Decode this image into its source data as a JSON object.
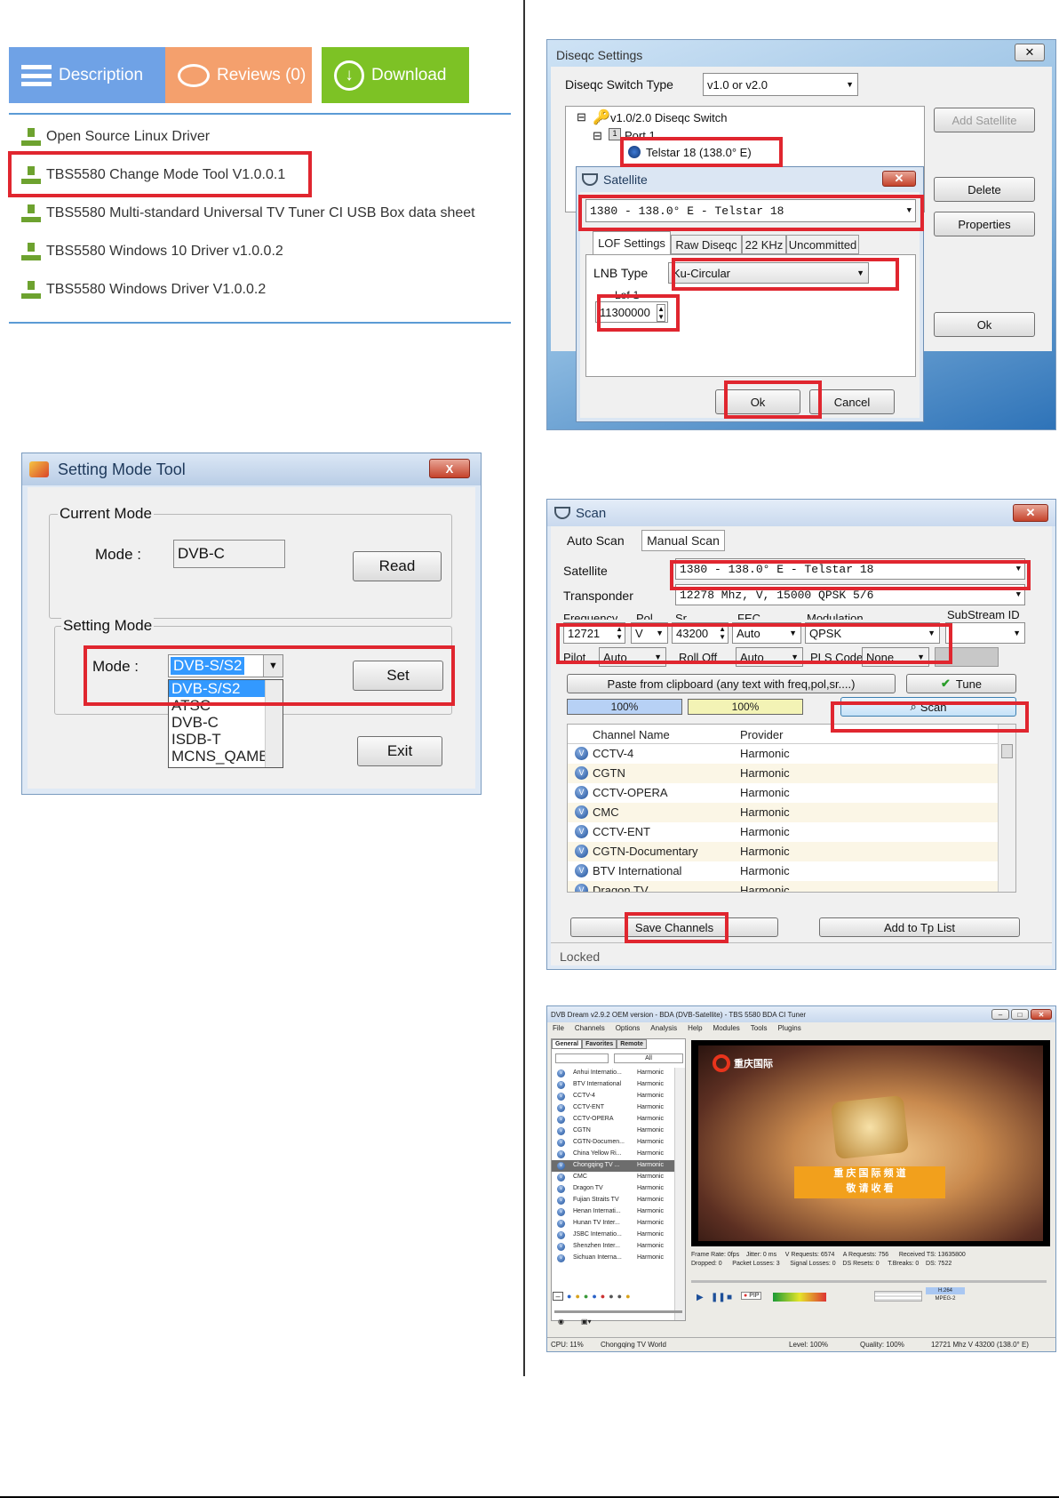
{
  "tabs": {
    "description": "Description",
    "reviews": "Reviews (0)",
    "download": "Download"
  },
  "downloads": [
    "Open Source Linux Driver",
    "TBS5580 Change Mode Tool V1.0.0.1",
    "TBS5580 Multi-standard Universal TV Tuner CI USB Box data sheet",
    "TBS5580 Windows 10 Driver v1.0.0.2",
    "TBS5580 Windows Driver V1.0.0.2"
  ],
  "mode_tool": {
    "title": "Setting Mode Tool",
    "current_group": "Current Mode",
    "mode_label": "Mode :",
    "current_value": "DVB-C",
    "read": "Read",
    "setting_group": "Setting Mode",
    "mode_label2": "Mode :",
    "selected": "DVB-S/S2",
    "options": [
      "DVB-S/S2",
      "ATSC",
      "DVB-C",
      "ISDB-T",
      "MCNS_QAMB"
    ],
    "set": "Set",
    "exit": "Exit",
    "close": "X"
  },
  "diseqc": {
    "title": "Diseqc Settings",
    "switch_label": "Diseqc Switch Type",
    "switch_value": "v1.0 or v2.0",
    "tree_root": "v1.0/2.0 Diseqc Switch",
    "tree_port": "Port 1",
    "tree_sat": "Telstar 18  (138.0° E)",
    "port_num": "1",
    "add_satellite": "Add Satellite",
    "delete": "Delete",
    "properties": "Properties",
    "ok": "Ok"
  },
  "satellite": {
    "title": "Satellite",
    "selected": "1380 - 138.0° E - Telstar 18",
    "tabs": [
      "LOF Settings",
      "Raw Diseqc",
      "22 KHz",
      "Uncommitted"
    ],
    "lnb_label": "LNB Type",
    "lnb_value": "Ku-Circular",
    "lof_label": "Lof-1",
    "lof_value": "11300000",
    "ok": "Ok",
    "cancel": "Cancel"
  },
  "scan": {
    "title": "Scan",
    "tab_auto": "Auto Scan",
    "tab_manual": "Manual Scan",
    "sat_label": "Satellite",
    "sat_value": "1380 - 138.0° E - Telstar 18",
    "tp_label": "Transponder",
    "tp_value": "12278 Mhz, V, 15000    QPSK 5/6",
    "hdr_freq": "Frequency",
    "hdr_pol": "Pol",
    "hdr_sr": "Sr",
    "hdr_fec": "FEC",
    "hdr_mod": "Modulation",
    "hdr_sub": "SubStream ID",
    "freq": "12721",
    "pol": "V",
    "sr": "43200",
    "fec": "Auto",
    "mod": "QPSK",
    "pilot_label": "Pilot",
    "pilot": "Auto",
    "rolloff_label": "Roll Off",
    "rolloff": "Auto",
    "pls_label": "PLS Code",
    "pls": "None",
    "paste": "Paste from clipboard   (any text with freq,pol,sr....)",
    "tune": "Tune",
    "level1": "100%",
    "level2": "100%",
    "scan_btn": "Scan",
    "col_name": "Channel Name",
    "col_provider": "Provider",
    "channels": [
      [
        "CCTV-4",
        "Harmonic"
      ],
      [
        "CGTN",
        "Harmonic"
      ],
      [
        "CCTV-OPERA",
        "Harmonic"
      ],
      [
        "CMC",
        "Harmonic"
      ],
      [
        "CCTV-ENT",
        "Harmonic"
      ],
      [
        "CGTN-Documentary",
        "Harmonic"
      ],
      [
        "BTV International",
        "Harmonic"
      ],
      [
        "Dragon TV",
        "Harmonic"
      ]
    ],
    "save": "Save Channels",
    "add_tp": "Add to Tp List",
    "status": "Locked"
  },
  "dvbdream": {
    "title": "DVB Dream v2.9.2 OEM version - BDA (DVB-Satellite) - TBS 5580 BDA CI Tuner",
    "menu": [
      "File",
      "Channels",
      "Options",
      "Analysis",
      "Help",
      "Modules",
      "Tools",
      "Plugins"
    ],
    "tabs": [
      "General",
      "Favorites",
      "Remote"
    ],
    "filter": "All",
    "channels": [
      [
        "Anhui Internatio...",
        "Harmonic"
      ],
      [
        "BTV International",
        "Harmonic"
      ],
      [
        "CCTV-4",
        "Harmonic"
      ],
      [
        "CCTV-ENT",
        "Harmonic"
      ],
      [
        "CCTV-OPERA",
        "Harmonic"
      ],
      [
        "CGTN",
        "Harmonic"
      ],
      [
        "CGTN-Documen...",
        "Harmonic"
      ],
      [
        "China Yellow Ri...",
        "Harmonic"
      ],
      [
        "Chongqing TV ...",
        "Harmonic"
      ],
      [
        "CMC",
        "Harmonic"
      ],
      [
        "Dragon TV",
        "Harmonic"
      ],
      [
        "Fujian Straits TV",
        "Harmonic"
      ],
      [
        "Henan Internati...",
        "Harmonic"
      ],
      [
        "Hunan TV Inter...",
        "Harmonic"
      ],
      [
        "JSBC Internatio...",
        "Harmonic"
      ],
      [
        "Shenzhen Inter...",
        "Harmonic"
      ],
      [
        "Sichuan Interna...",
        "Harmonic"
      ]
    ],
    "logo": "重庆国际",
    "video_line1": "重 庆 国 际 频 道",
    "video_line2": "敬 请 收 看",
    "stats1": "Frame Rate: 0fps    Jitter: 0 ms     V Requests: 6574     A Requests: 756      Received TS: 13635800",
    "stats2": "Dropped: 0      Packet Losses: 3      Signal Losses: 0    DS Resets: 0     T.Breaks: 0    DS: 7522",
    "pip": "PIP",
    "codec1": "H.264",
    "codec2": "MPEG-2",
    "status_cpu": "CPU: 11%",
    "status_ch": "Chongqing TV World",
    "status_level": "Level: 100%",
    "status_quality": "Quality: 100%",
    "status_tp": "12721 Mhz  V  43200  (138.0° E)"
  }
}
